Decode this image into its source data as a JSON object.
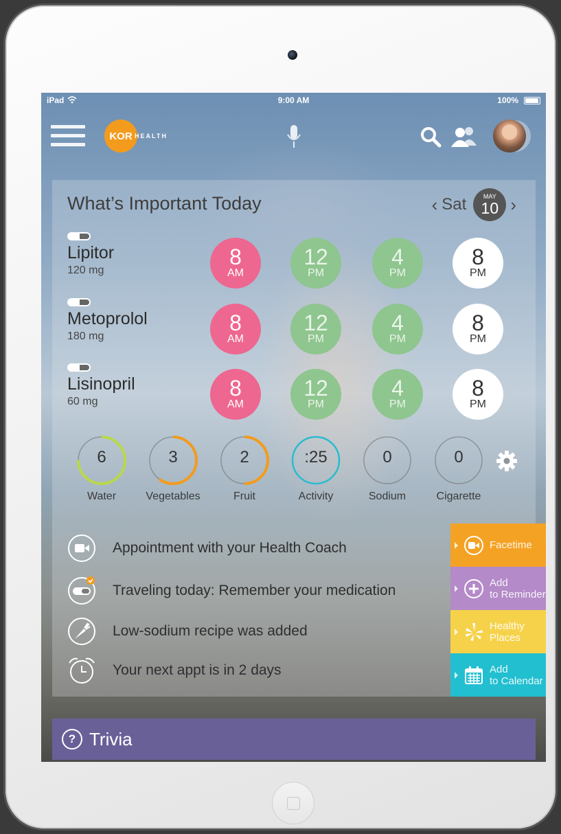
{
  "status": {
    "device": "iPad",
    "time": "9:00 AM",
    "battery": "100%"
  },
  "header": {
    "logo_mark": "KOR",
    "logo_text": "HEALTH",
    "icons": [
      "menu-icon",
      "microphone-icon",
      "search-icon",
      "people-icon",
      "avatar"
    ]
  },
  "today": {
    "title": "What’s Important Today",
    "day": "Sat",
    "month": "MAY",
    "date": "10"
  },
  "medications": [
    {
      "name": "Lipitor",
      "dose": "120 mg",
      "times": [
        {
          "h": "8",
          "p": "AM",
          "state": "missed"
        },
        {
          "h": "12",
          "p": "PM",
          "state": "taken"
        },
        {
          "h": "4",
          "p": "PM",
          "state": "taken"
        },
        {
          "h": "8",
          "p": "PM",
          "state": "upcoming"
        }
      ]
    },
    {
      "name": "Metoprolol",
      "dose": "180 mg",
      "times": [
        {
          "h": "8",
          "p": "AM",
          "state": "missed"
        },
        {
          "h": "12",
          "p": "PM",
          "state": "taken"
        },
        {
          "h": "4",
          "p": "PM",
          "state": "taken"
        },
        {
          "h": "8",
          "p": "PM",
          "state": "upcoming"
        }
      ]
    },
    {
      "name": "Lisinopril",
      "dose": "60 mg",
      "times": [
        {
          "h": "8",
          "p": "AM",
          "state": "missed"
        },
        {
          "h": "12",
          "p": "PM",
          "state": "taken"
        },
        {
          "h": "4",
          "p": "PM",
          "state": "taken"
        },
        {
          "h": "8",
          "p": "PM",
          "state": "upcoming"
        }
      ]
    }
  ],
  "trackers": [
    {
      "value": "6",
      "label": "Water",
      "color": "#b9d84a",
      "progress": 0.75
    },
    {
      "value": "3",
      "label": "Vegetables",
      "color": "#f39b1d",
      "progress": 0.6
    },
    {
      "value": "2",
      "label": "Fruit",
      "color": "#f39b1d",
      "progress": 0.5
    },
    {
      "value": ":25",
      "label": "Activity",
      "color": "#29bcd0",
      "progress": 1.0
    },
    {
      "value": "0",
      "label": "Sodium",
      "color": "#888888",
      "progress": 0
    },
    {
      "value": "0",
      "label": "Cigarette",
      "color": "#888888",
      "progress": 0
    }
  ],
  "notifications": [
    {
      "icon": "video-icon",
      "text": "Appointment with your Health Coach"
    },
    {
      "icon": "pill-check-icon",
      "text": "Traveling today: Remember your medication"
    },
    {
      "icon": "carrot-icon",
      "text": "Low-sodium recipe was added"
    },
    {
      "icon": "alarm-clock-icon",
      "text": "Your next appt is in 2 days"
    }
  ],
  "actions": [
    {
      "icon": "facetime-icon",
      "label": "Facetime",
      "color": "#f4a224"
    },
    {
      "icon": "plus-icon",
      "label": "Add to Reminder",
      "color": "#b48ac8"
    },
    {
      "icon": "yelp-icon",
      "label": "Healthy Places",
      "color": "#f6d24a"
    },
    {
      "icon": "calendar-icon",
      "label": "Add to Calendar",
      "color": "#22bfd0"
    }
  ],
  "trivia": {
    "label": "Trivia"
  },
  "colors": {
    "missed": "#ee6790",
    "taken": "#8fc58f",
    "upcoming": "#ffffff",
    "trivia_bg": "#6a6098",
    "brand": "#f39b1d"
  }
}
